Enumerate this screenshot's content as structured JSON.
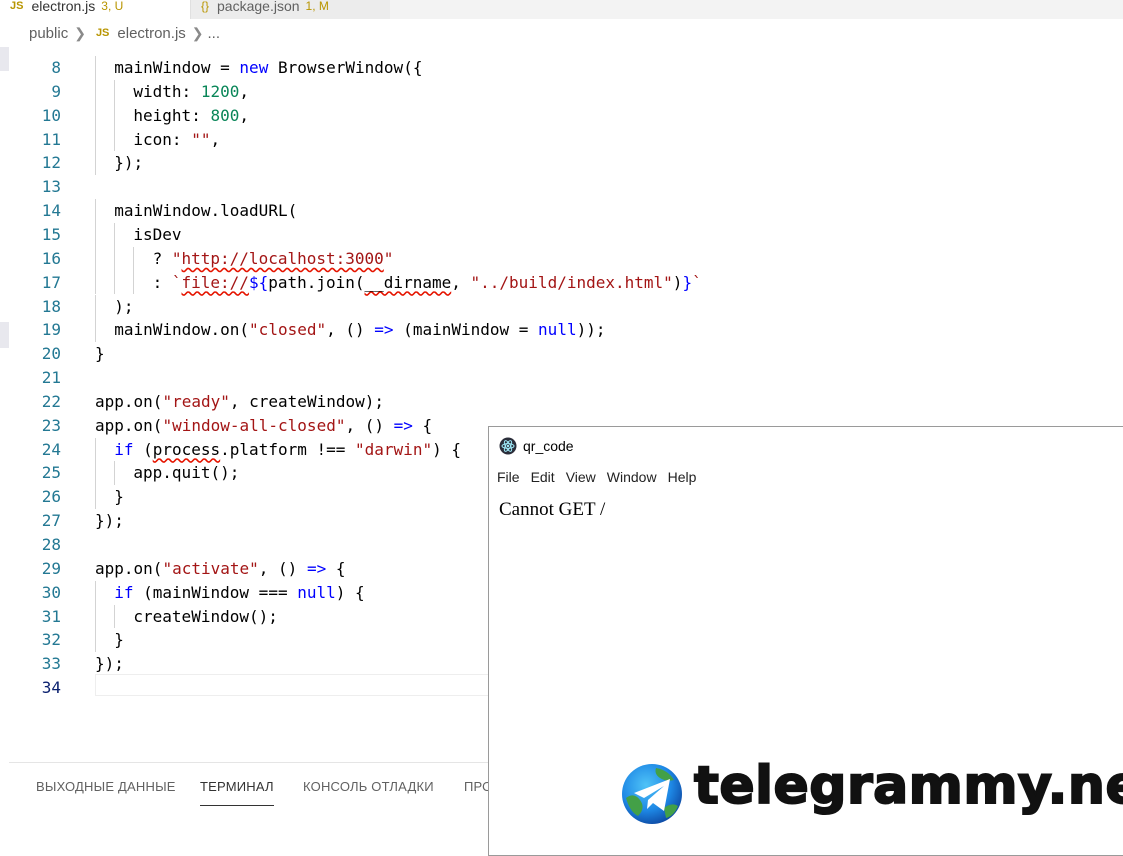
{
  "tabs": [
    {
      "icon": "JS",
      "label": "electron.js",
      "status": "3, U"
    },
    {
      "icon": "{}",
      "label": "package.json",
      "status": "1, M"
    }
  ],
  "breadcrumb": {
    "folder": "public",
    "file_icon": "JS",
    "file": "electron.js",
    "more": "..."
  },
  "editor": {
    "lines": [
      {
        "n": "8",
        "html": "mainWindow = <span class=\"kw\">new</span> BrowserWindow({",
        "indent": 1
      },
      {
        "n": "9",
        "html": "width: <span class=\"num\">1200</span>,",
        "indent": 2
      },
      {
        "n": "10",
        "html": "height: <span class=\"num\">800</span>,",
        "indent": 2
      },
      {
        "n": "11",
        "html": "icon: <span class=\"str\">\"\"</span>,",
        "indent": 2
      },
      {
        "n": "12",
        "html": "});",
        "indent": 1
      },
      {
        "n": "13",
        "html": "",
        "indent": 0
      },
      {
        "n": "14",
        "html": "mainWindow.loadURL(",
        "indent": 1
      },
      {
        "n": "15",
        "html": "isDev",
        "indent": 2
      },
      {
        "n": "16",
        "html": "? <span class=\"str\">\"<span class=\"sq\">http://localhost:3000</span>\"</span>",
        "indent": 3
      },
      {
        "n": "17",
        "html": ": <span class=\"str\">`<span class=\"sq\">file://</span></span><span class=\"kw\">${</span>path.join(<span class=\"sq\">__dirname</span>, <span class=\"str\">\"../build/index.html\"</span>)<span class=\"kw\">}</span><span class=\"str\">`</span>",
        "indent": 3
      },
      {
        "n": "18",
        "html": ");",
        "indent": 1
      },
      {
        "n": "19",
        "html": "mainWindow.on(<span class=\"str\">\"closed\"</span>, () <span class=\"kw\">=&gt;</span> (mainWindow = <span class=\"kw\">null</span>));",
        "indent": 1
      },
      {
        "n": "20",
        "html": "}",
        "indent": 0
      },
      {
        "n": "21",
        "html": "",
        "indent": 0
      },
      {
        "n": "22",
        "html": "app.on(<span class=\"str\">\"ready\"</span>, createWindow);",
        "indent": 0
      },
      {
        "n": "23",
        "html": "app.on(<span class=\"str\">\"window-all-closed\"</span>, () <span class=\"kw\">=&gt;</span> {",
        "indent": 0
      },
      {
        "n": "24",
        "html": "<span class=\"kw\">if</span> (<span class=\"sq\">process</span>.platform !== <span class=\"str\">\"darwin\"</span>) {",
        "indent": 1
      },
      {
        "n": "25",
        "html": "app.quit();",
        "indent": 2
      },
      {
        "n": "26",
        "html": "}",
        "indent": 1
      },
      {
        "n": "27",
        "html": "});",
        "indent": 0
      },
      {
        "n": "28",
        "html": "",
        "indent": 0
      },
      {
        "n": "29",
        "html": "app.on(<span class=\"str\">\"activate\"</span>, () <span class=\"kw\">=&gt;</span> {",
        "indent": 0
      },
      {
        "n": "30",
        "html": "<span class=\"kw\">if</span> (mainWindow === <span class=\"kw\">null</span>) {",
        "indent": 1
      },
      {
        "n": "31",
        "html": "createWindow();",
        "indent": 2
      },
      {
        "n": "32",
        "html": "}",
        "indent": 1
      },
      {
        "n": "33",
        "html": "});",
        "indent": 0
      },
      {
        "n": "34",
        "html": "",
        "indent": 0,
        "current": true
      }
    ]
  },
  "panel": {
    "tabs": [
      "ВЫХОДНЫЕ ДАННЫЕ",
      "ТЕРМИНАЛ",
      "КОНСОЛЬ ОТЛАДКИ",
      "ПРО"
    ],
    "active": "ТЕРМИНАЛ"
  },
  "app_window": {
    "title": "qr_code",
    "menu": [
      "File",
      "Edit",
      "View",
      "Window",
      "Help"
    ],
    "body_text": "Cannot GET /"
  },
  "watermark": {
    "text": "telegrammy.net"
  },
  "colors": {
    "keyword": "#0000ff",
    "number": "#098658",
    "string": "#a31515",
    "line_number": "#237893",
    "accent_js": "#b89500"
  }
}
